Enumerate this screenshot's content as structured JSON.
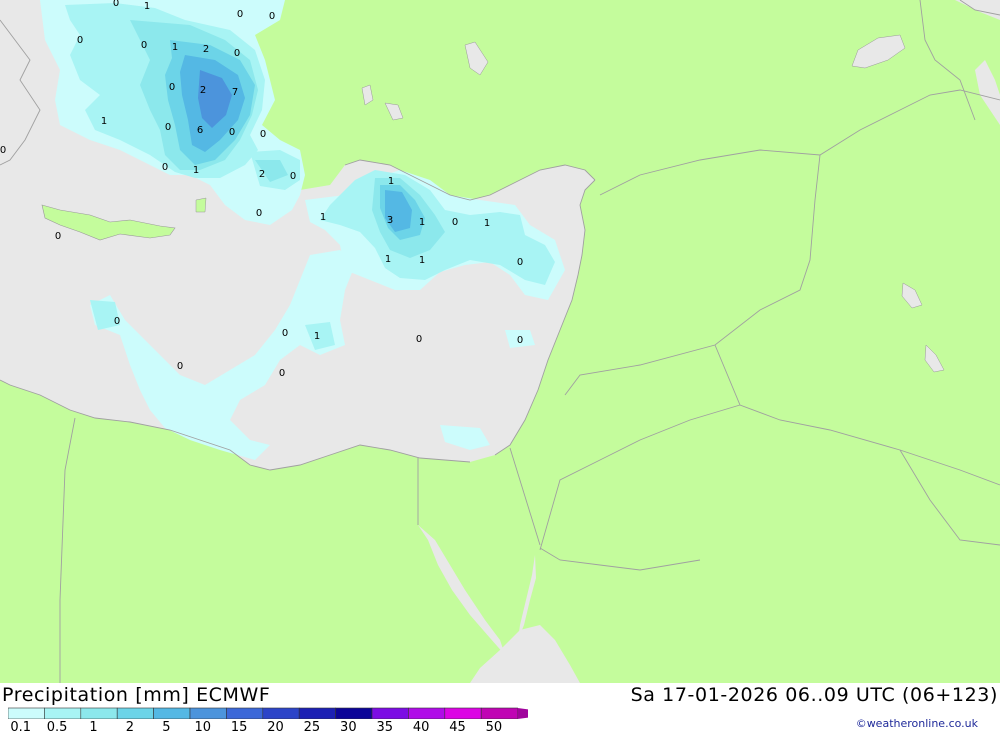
{
  "header": {
    "product": "Precipitation [mm] ECMWF",
    "valid": "Sa 17-01-2026 06..09 UTC (06+123)"
  },
  "legend": {
    "levels": [
      "0.1",
      "0.5",
      "1",
      "2",
      "5",
      "10",
      "15",
      "20",
      "25",
      "30",
      "35",
      "40",
      "45",
      "50"
    ],
    "colors": [
      "#ccfcfc",
      "#a8f4f4",
      "#8ce8ec",
      "#6cd4e8",
      "#54b8e4",
      "#4c94dc",
      "#3c68d8",
      "#2c44c8",
      "#1c20b4",
      "#0c0498",
      "#7c0ce4",
      "#b00ce8",
      "#dc04e4",
      "#c004b4",
      "#a0049c"
    ]
  },
  "colors": {
    "land": "#c4fc9c",
    "sea": "#e8e8e8",
    "border": "#a0a0a0"
  },
  "precip_values": [
    "0",
    "1",
    "0",
    "0",
    "0",
    "0",
    "1",
    "2",
    "0",
    "0",
    "2",
    "7",
    "1",
    "0",
    "6",
    "0",
    "0",
    "0",
    "1",
    "2",
    "0",
    "0",
    "1",
    "3",
    "1",
    "0",
    "1",
    "1",
    "1",
    "0",
    "0",
    "0",
    "1",
    "0",
    "0",
    "0",
    "0",
    "1",
    "0",
    "0"
  ],
  "credit": "©weatheronline.co.uk"
}
